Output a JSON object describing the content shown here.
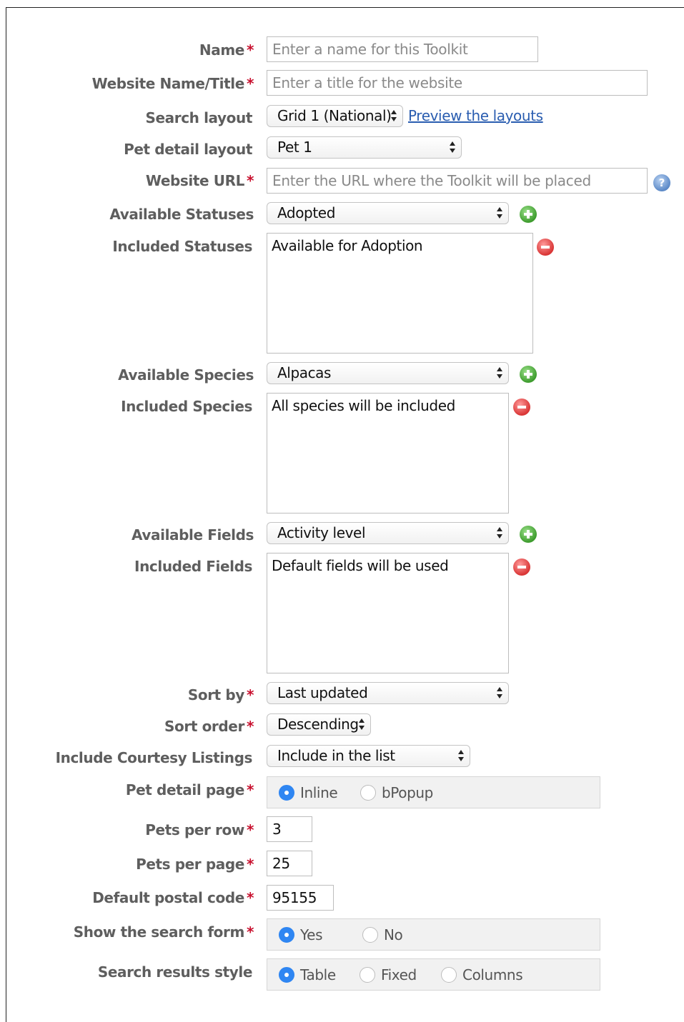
{
  "fields": {
    "name": {
      "label": "Name",
      "placeholder": "Enter a name for this Toolkit"
    },
    "website_title": {
      "label": "Website Name/Title",
      "placeholder": "Enter a title for the website"
    },
    "search_layout": {
      "label": "Search layout",
      "value": "Grid 1 (National)",
      "link": "Preview the layouts"
    },
    "pet_detail_layout": {
      "label": "Pet detail layout",
      "value": "Pet 1"
    },
    "website_url": {
      "label": "Website URL",
      "placeholder": "Enter the URL where the Toolkit will be placed",
      "help": "?"
    },
    "available_statuses": {
      "label": "Available Statuses",
      "value": "Adopted"
    },
    "included_statuses": {
      "label": "Included Statuses",
      "value": "Available for Adoption"
    },
    "available_species": {
      "label": "Available Species",
      "value": "Alpacas"
    },
    "included_species": {
      "label": "Included Species",
      "value": "All species will be included"
    },
    "available_fields": {
      "label": "Available Fields",
      "value": "Activity level"
    },
    "included_fields": {
      "label": "Included Fields",
      "value": "Default fields will be used"
    },
    "sort_by": {
      "label": "Sort by",
      "value": "Last updated"
    },
    "sort_order": {
      "label": "Sort order",
      "value": "Descending"
    },
    "courtesy": {
      "label": "Include Courtesy Listings",
      "value": "Include in the list"
    },
    "pet_detail_page": {
      "label": "Pet detail page",
      "options": [
        "Inline",
        "bPopup"
      ],
      "selected": "Inline"
    },
    "pets_per_row": {
      "label": "Pets per row",
      "value": "3"
    },
    "pets_per_page": {
      "label": "Pets per page",
      "value": "25"
    },
    "postal_code": {
      "label": "Default postal code",
      "value": "95155"
    },
    "show_search_form": {
      "label": "Show the search form",
      "options": [
        "Yes",
        "No"
      ],
      "selected": "Yes"
    },
    "search_results_style": {
      "label": "Search results style",
      "options": [
        "Table",
        "Fixed",
        "Columns"
      ],
      "selected": "Table"
    }
  },
  "required_marker": "*",
  "colors": {
    "required": "#c8102e",
    "radio_selected": "#2f86f2",
    "link": "#2a5db0",
    "label": "#5e5e5e"
  }
}
